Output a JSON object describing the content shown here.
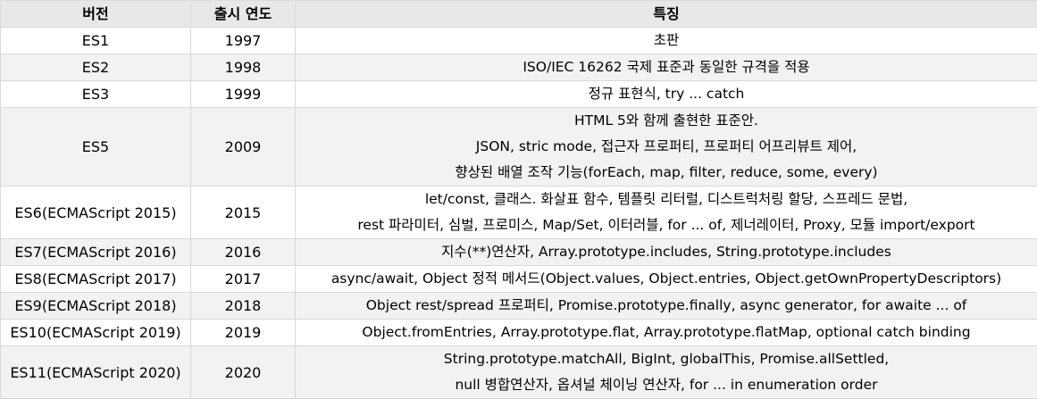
{
  "table": {
    "headers": [
      "버전",
      "출시 연도",
      "특징"
    ],
    "rows": [
      {
        "version": "ES1",
        "year": "1997",
        "features": [
          "초판"
        ]
      },
      {
        "version": "ES2",
        "year": "1998",
        "features": [
          "ISO/IEC 16262 국제 표준과 동일한 규격을 적용"
        ]
      },
      {
        "version": "ES3",
        "year": "1999",
        "features": [
          "정규 표현식, try ... catch"
        ]
      },
      {
        "version": "ES5",
        "year": "2009",
        "features": [
          "HTML 5와 함께 출현한 표준안.",
          "JSON, stric mode, 접근자 프로퍼티, 프로퍼티 어프리뷰트 제어,",
          "향상된 배열 조작 기능(forEach, map, filter, reduce, some, every)"
        ]
      },
      {
        "version": "ES6(ECMAScript 2015)",
        "year": "2015",
        "features": [
          "let/const, 클래스. 화살표 함수, 템플릿 리터럴, 디스트럭처링 할당, 스프레드 문법,",
          "rest 파라미터, 심벌, 프로미스, Map/Set, 이터러블, for ... of, 제너레이터, Proxy, 모듈 import/export"
        ]
      },
      {
        "version": "ES7(ECMAScript 2016)",
        "year": "2016",
        "features": [
          "지수(**)연산자, Array.prototype.includes, String.prototype.includes"
        ]
      },
      {
        "version": "ES8(ECMAScript 2017)",
        "year": "2017",
        "features": [
          "async/await, Object 정적 메서드(Object.values, Object.entries, Object.getOwnPropertyDescriptors)"
        ]
      },
      {
        "version": "ES9(ECMAScript 2018)",
        "year": "2018",
        "features": [
          "Object rest/spread 프로퍼티, Promise.prototype.finally, async generator, for awaite ... of"
        ]
      },
      {
        "version": "ES10(ECMAScript 2019)",
        "year": "2019",
        "features": [
          "Object.fromEntries, Array.prototype.flat, Array.prototype.flatMap, optional catch binding"
        ]
      },
      {
        "version": "ES11(ECMAScript 2020)",
        "year": "2020",
        "features": [
          "String.prototype.matchAll, BigInt, globalThis, Promise.allSettled,",
          "null 병합연산자, 옵셔널 체이닝 연산자, for ... in enumeration order"
        ]
      }
    ]
  }
}
